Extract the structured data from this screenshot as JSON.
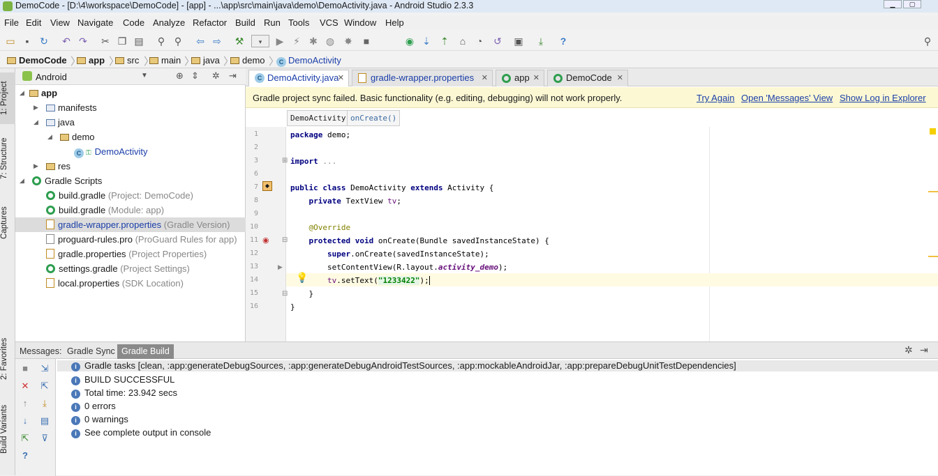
{
  "window": {
    "title": "DemoCode - [D:\\4\\workspace\\DemoCode] - [app] - ...\\app\\src\\main\\java\\demo\\DemoActivity.java - Android Studio 2.3.3",
    "minimize": "▁",
    "maximize": "▢"
  },
  "menu": [
    "File",
    "Edit",
    "View",
    "Navigate",
    "Code",
    "Analyze",
    "Refactor",
    "Build",
    "Run",
    "Tools",
    "VCS",
    "Window",
    "Help"
  ],
  "breadcrumb": [
    "DemoCode",
    "app",
    "src",
    "main",
    "java",
    "demo",
    "DemoActivity"
  ],
  "left_tabs": [
    "1: Project",
    "7: Structure",
    "Captures",
    "2: Favorites",
    "Build Variants"
  ],
  "project": {
    "view": "Android",
    "tree": [
      {
        "label": "app",
        "hint": ""
      },
      {
        "label": "manifests",
        "hint": ""
      },
      {
        "label": "java",
        "hint": ""
      },
      {
        "label": "demo",
        "hint": ""
      },
      {
        "label": "DemoActivity",
        "hint": ""
      },
      {
        "label": "res",
        "hint": ""
      },
      {
        "label": "Gradle Scripts",
        "hint": ""
      },
      {
        "label": "build.gradle",
        "hint": "(Project: DemoCode)"
      },
      {
        "label": "build.gradle",
        "hint": "(Module: app)"
      },
      {
        "label": "gradle-wrapper.properties",
        "hint": "(Gradle Version)"
      },
      {
        "label": "proguard-rules.pro",
        "hint": "(ProGuard Rules for app)"
      },
      {
        "label": "gradle.properties",
        "hint": "(Project Properties)"
      },
      {
        "label": "settings.gradle",
        "hint": "(Project Settings)"
      },
      {
        "label": "local.properties",
        "hint": "(SDK Location)"
      }
    ]
  },
  "editor_tabs": [
    "DemoActivity.java",
    "gradle-wrapper.properties",
    "app",
    "DemoCode"
  ],
  "sync_banner": {
    "message": "Gradle project sync failed. Basic functionality (e.g. editing, debugging) will not work properly.",
    "try_again": "Try Again",
    "open_messages": "Open 'Messages' View",
    "show_log": "Show Log in Explorer"
  },
  "code_crumbs": [
    "DemoActivity",
    "onCreate()"
  ],
  "code": {
    "line_numbers": [
      "1",
      "2",
      "3",
      "6",
      "7",
      "8",
      "9",
      "10",
      "11",
      "12",
      "13",
      "14",
      "15",
      "16"
    ]
  },
  "messages": {
    "label": "Messages:",
    "tabs": [
      "Gradle Sync",
      "Gradle Build"
    ],
    "rows": [
      "Gradle tasks [clean, :app:generateDebugSources, :app:generateDebugAndroidTestSources, :app:mockableAndroidJar, :app:prepareDebugUnitTestDependencies]",
      "BUILD SUCCESSFUL",
      "Total time: 23.942 secs",
      "0 errors",
      "0 warnings",
      "See complete output in console"
    ]
  },
  "colors": {
    "banner_bg": "#fcf8d4",
    "link": "#1a3ea8",
    "selected_row": "#dcdcdc",
    "active_bottom_tab": "#8a8a8a"
  }
}
